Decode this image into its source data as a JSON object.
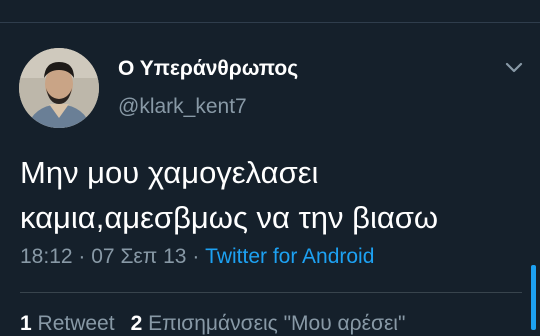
{
  "tweet": {
    "author": {
      "display_name": "Ο Υπεράνθρωπος",
      "handle": "@klark_kent7"
    },
    "text_lines": [
      "Μην μου χαμογελασει",
      "καμια,αμεσβμως να την βιασω"
    ],
    "time": "18:12",
    "separator": "·",
    "date": "07 Σεπ 13",
    "source": "Twitter for Android",
    "stats": {
      "retweets_count": "1",
      "retweets_label": "Retweet",
      "likes_count": "2",
      "likes_label": "Επισημάνσεις \"Μου αρέσει\""
    }
  },
  "icons": {
    "menu": "chevron-down-icon"
  },
  "colors": {
    "background": "#15202b",
    "primary_text": "#ffffff",
    "secondary_text": "#8899a6",
    "link": "#1da1f2",
    "divider": "#38444d"
  }
}
